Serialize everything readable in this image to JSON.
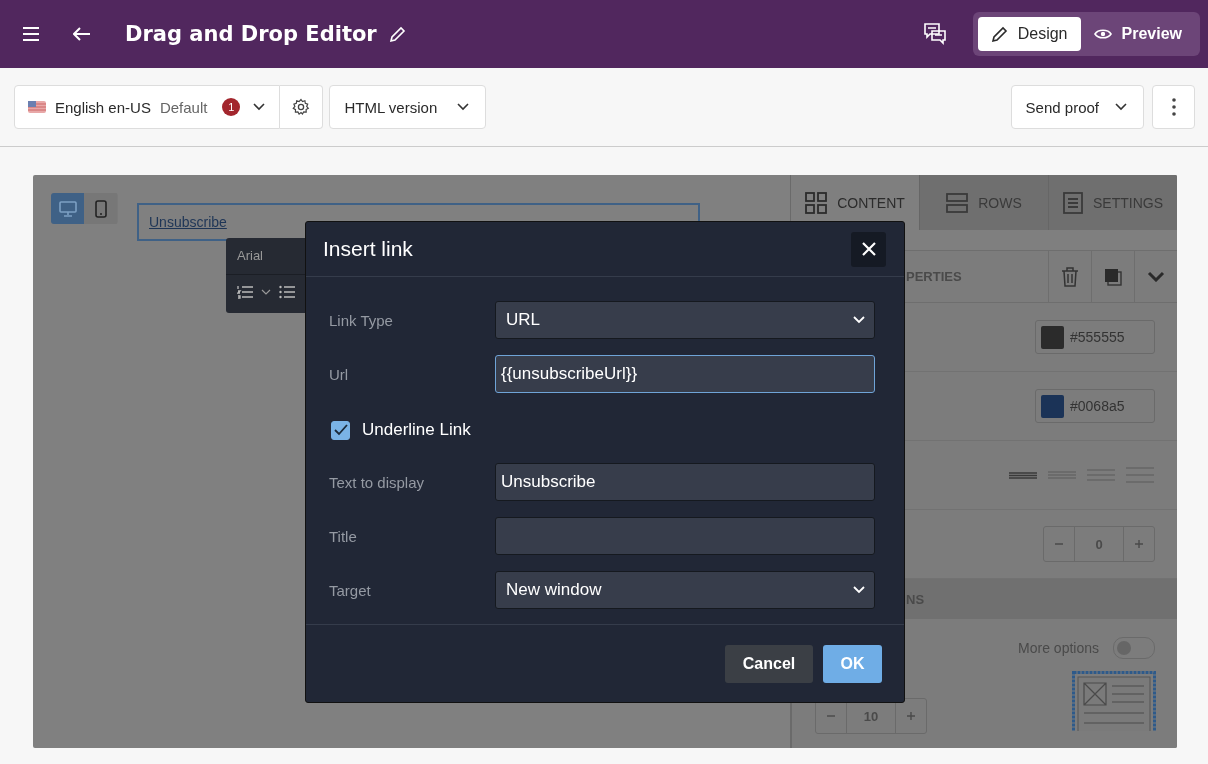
{
  "header": {
    "title": "Drag and Drop Editor",
    "mode_tabs": [
      {
        "kind": "design",
        "label": "Design",
        "selected": true
      },
      {
        "kind": "preview",
        "label": "Preview",
        "selected": false
      }
    ]
  },
  "toolbar": {
    "language": {
      "name": "English en-US",
      "tag": "Default",
      "badge": "1"
    },
    "version": "HTML version",
    "send_proof": "Send proof"
  },
  "canvas": {
    "devices": [
      {
        "kind": "desktop",
        "selected": true
      },
      {
        "kind": "mobile",
        "selected": false
      }
    ],
    "link_text": "Unsubscribe",
    "font_toolbar": {
      "font": "Arial"
    }
  },
  "panel": {
    "tabs": [
      {
        "kind": "content",
        "label": "CONTENT",
        "selected": true
      },
      {
        "kind": "rows",
        "label": "ROWS",
        "selected": false
      },
      {
        "kind": "settings",
        "label": "SETTINGS",
        "selected": false
      }
    ],
    "properties_title": "PERTIES",
    "color_fields": [
      {
        "value": "#555555",
        "color": "#2b2b2b"
      },
      {
        "value": "#0068a5",
        "color": "#1b3357"
      }
    ],
    "alignments": [
      {
        "selected": true
      },
      {
        "selected": false
      },
      {
        "selected": false
      },
      {
        "selected": false
      }
    ],
    "stepper_value": "0",
    "section_title": "NS",
    "more_options": {
      "label": "More options",
      "on": false
    },
    "stepper_value_2": "10"
  },
  "dialog": {
    "title": "Insert link",
    "fields": [
      {
        "kind": "select",
        "label": "Link Type",
        "value": "URL"
      },
      {
        "kind": "text",
        "label": "Url",
        "value": "{{unsubscribeUrl}}",
        "focused": true
      },
      {
        "kind": "checkbox",
        "label": "Underline Link",
        "checked": true
      },
      {
        "kind": "text",
        "label": "Text to display",
        "value": "Unsubscribe",
        "focused": false
      },
      {
        "kind": "text",
        "label": "Title",
        "focused": false
      },
      {
        "kind": "select",
        "label": "Target",
        "value": "New window"
      }
    ],
    "buttons": [
      {
        "kind": "secondary",
        "label": "Cancel"
      },
      {
        "kind": "primary",
        "label": "OK"
      }
    ]
  }
}
